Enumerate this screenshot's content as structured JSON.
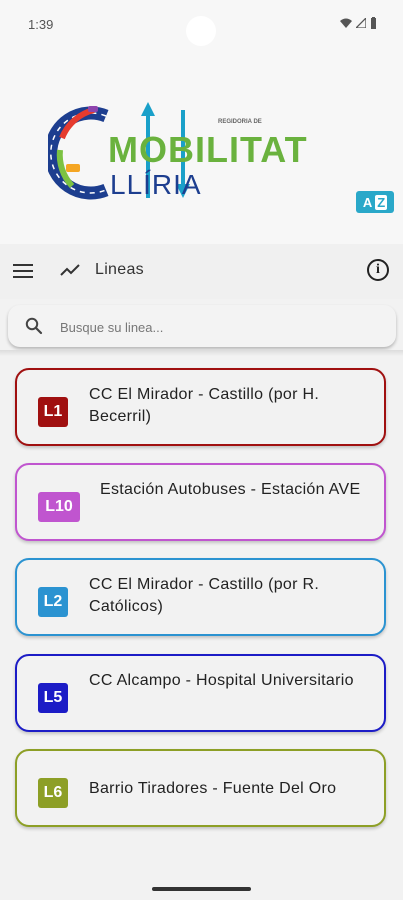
{
  "status_bar": {
    "time": "1:39"
  },
  "header": {
    "logo_small_text": "REGIDORIA DE",
    "logo_main": "MOBILITAT",
    "logo_sub": "LLÍRIA",
    "accessibility_badge": "A",
    "accessibility_badge_suffix": "Z"
  },
  "toolbar": {
    "title": "Lineas"
  },
  "search": {
    "placeholder": "Busque su linea..."
  },
  "lines": [
    {
      "code": "L1",
      "name": "CC El Mirador - Castillo (por H. Becerril)",
      "color": "#a01010"
    },
    {
      "code": "L10",
      "name": "Estación Autobuses - Estación AVE",
      "color": "#c055cf"
    },
    {
      "code": "L2",
      "name": "CC El Mirador - Castillo (por R. Católicos)",
      "color": "#2b93d1"
    },
    {
      "code": "L5",
      "name": "CC Alcampo - Hospital Universitario",
      "color": "#1c1cc6"
    },
    {
      "code": "L6",
      "name": "Barrio Tiradores - Fuente Del Oro",
      "color": "#8d9f26"
    }
  ]
}
